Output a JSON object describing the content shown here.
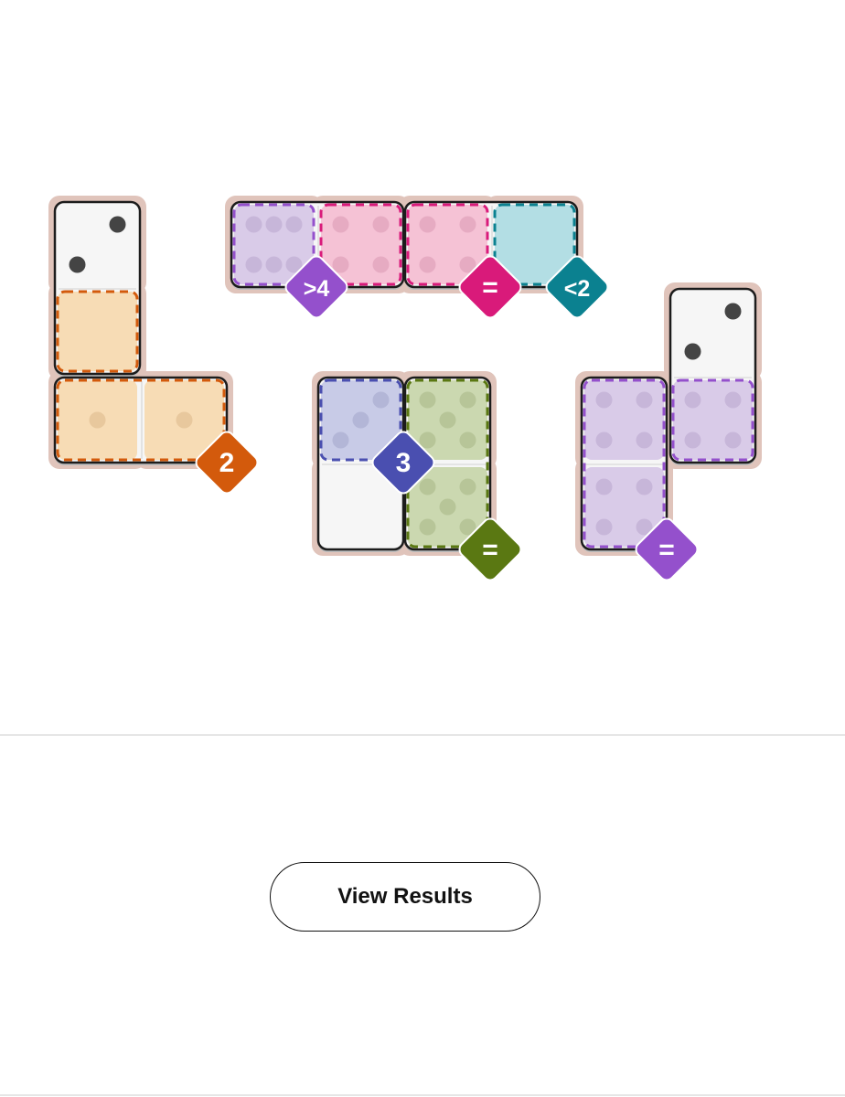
{
  "colors": {
    "tray": "#e0c4bb",
    "tile_face": "#f6f6f6",
    "tile_border": "#1c1c1c",
    "pip_default": "#444444"
  },
  "dominoes": [
    {
      "name": "domino-1",
      "pips": [
        2,
        0
      ]
    },
    {
      "name": "domino-2",
      "pips": [
        1,
        1
      ]
    },
    {
      "name": "domino-3",
      "pips": [
        6,
        4
      ]
    },
    {
      "name": "domino-4",
      "pips": [
        4,
        0
      ]
    },
    {
      "name": "domino-5",
      "pips": [
        3,
        0
      ]
    },
    {
      "name": "domino-6",
      "pips": [
        5,
        5
      ]
    },
    {
      "name": "domino-7",
      "pips": [
        2,
        4
      ]
    },
    {
      "name": "domino-8",
      "pips": [
        4,
        4
      ]
    }
  ],
  "regions": [
    {
      "name": "region-orange-sum",
      "color": "#d35a0c",
      "fill": "#f7d9ae",
      "label": "2"
    },
    {
      "name": "region-purple-greater",
      "color": "#9450cc",
      "fill": "#d6c7e7",
      "label": ">4"
    },
    {
      "name": "region-pink-equal",
      "color": "#d91a7a",
      "fill": "#f5bcd2",
      "label": "="
    },
    {
      "name": "region-teal-less",
      "color": "#0b8190",
      "fill": "#acdce2",
      "label": "<2"
    },
    {
      "name": "region-blue-sum",
      "color": "#4a4fb0",
      "fill": "#c3c7e6",
      "label": "3"
    },
    {
      "name": "region-green-equal",
      "color": "#5a7812",
      "fill": "#c6d5a8",
      "label": "="
    },
    {
      "name": "region-lavender-equal",
      "color": "#9450cc",
      "fill": "#d6c7e7",
      "label": "="
    }
  ],
  "actions": {
    "view_results_label": "View Results"
  }
}
